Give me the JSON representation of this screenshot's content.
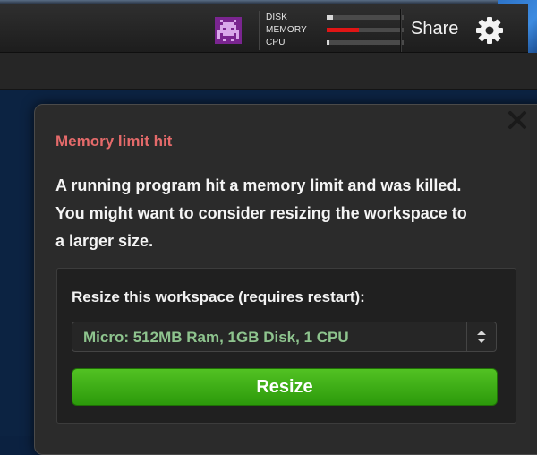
{
  "topbar": {
    "avatar_icon": "pixel-invader-icon",
    "avatar_color": "#8a2c9a",
    "meters": [
      {
        "label": "DISK",
        "fill": 0.08,
        "color": "#d8d8d8"
      },
      {
        "label": "MEMORY",
        "fill": 0.42,
        "color": "#e01515"
      },
      {
        "label": "CPU",
        "fill": 0.03,
        "color": "#d8d8d8"
      }
    ],
    "share_label": "Share",
    "settings_icon": "gear-icon"
  },
  "dialog": {
    "close_icon": "close-icon",
    "title": "Memory limit hit",
    "title_color": "#e46a6a",
    "message": "A running program hit a memory limit and was killed. You might want to consider resizing the workspace to a larger size.",
    "resize_panel": {
      "label": "Resize this workspace (requires restart):",
      "select_value": "Micro: 512MB Ram, 1GB Disk, 1 CPU",
      "select_icon": "up-down-arrows-icon",
      "button_label": "Resize",
      "button_color": "#3aab14"
    }
  }
}
